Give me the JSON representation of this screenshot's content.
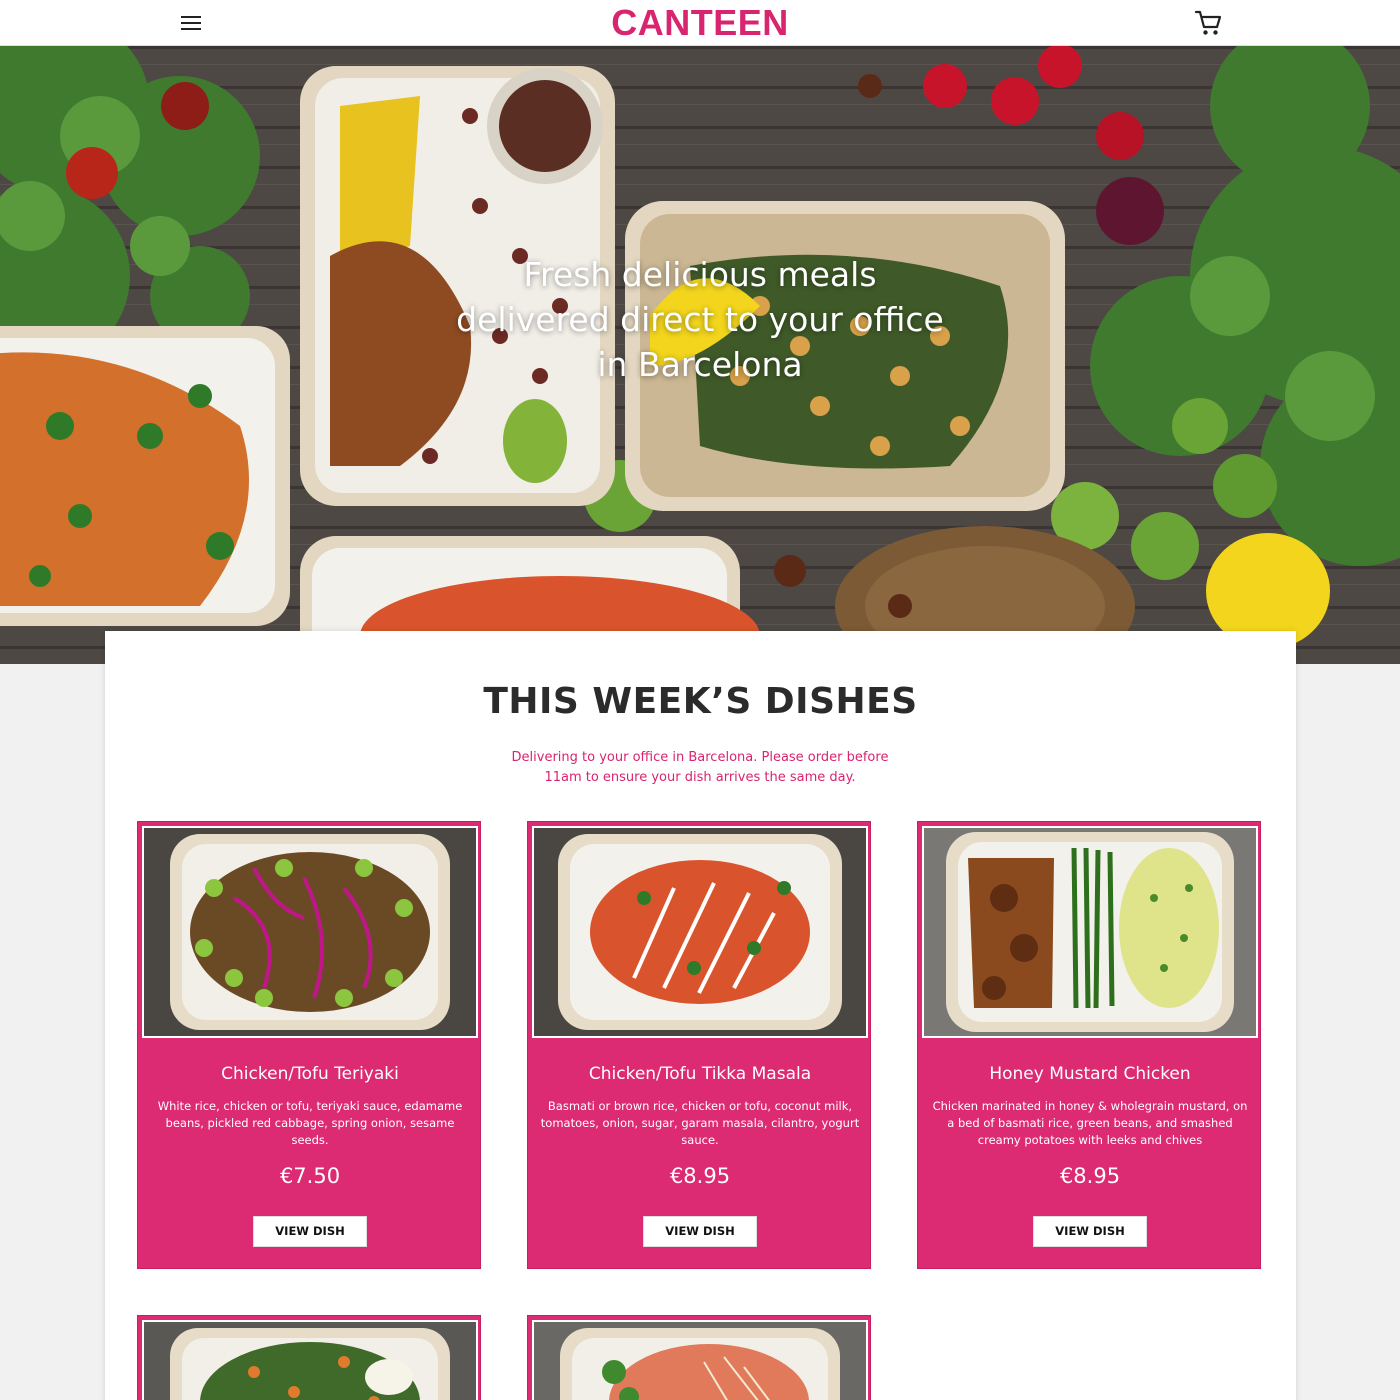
{
  "header": {
    "logo": "CANTEEN",
    "menu_icon": "hamburger-menu-icon",
    "cart_icon": "shopping-cart-icon"
  },
  "hero": {
    "title": "Fresh delicious meals delivered direct to your office in Barcelona"
  },
  "section": {
    "title": "THIS WEEK’S DISHES",
    "subtitle": "Delivering to your office in Barcelona. Please order before 11am to ensure your dish arrives the same day."
  },
  "dishes": [
    {
      "name": "Chicken/Tofu Teriyaki",
      "description": "White rice, chicken or tofu, teriyaki sauce, edamame beans, pickled red cabbage, spring onion, sesame seeds.",
      "price": "€7.50",
      "button": "VIEW DISH"
    },
    {
      "name": "Chicken/Tofu Tikka Masala",
      "description": "Basmati or brown rice, chicken or tofu, coconut milk, tomatoes, onion, sugar, garam masala, cilantro, yogurt sauce.",
      "price": "€8.95",
      "button": "VIEW DISH"
    },
    {
      "name": "Honey Mustard Chicken",
      "description": "Chicken marinated in honey & wholegrain mustard, on a bed of basmati rice, green beans, and smashed creamy potatoes with leeks and chives",
      "price": "€8.95",
      "button": "VIEW DISH"
    }
  ],
  "colors": {
    "brand": "#d9246f",
    "card": "#dc2a73",
    "panel": "#ffffff",
    "page_bg": "#f1f1f1"
  }
}
